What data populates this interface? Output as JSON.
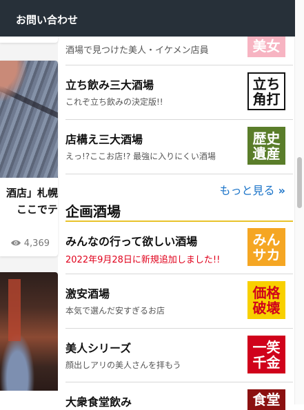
{
  "header": {
    "title": "お問い合わせ"
  },
  "left_cards": {
    "card1": {
      "title_line1": "酒店」札幌",
      "title_line2": "ここでテ",
      "views": "4,369"
    }
  },
  "ranking_items": [
    {
      "desc": "酒場で見つけた美人・イケメン店員",
      "icon_text": "美女",
      "icon_bg": "#f7b4c2",
      "icon_fg": "#ffffff"
    },
    {
      "title": "立ち飲み三大酒場",
      "desc": "これぞ立ち飲みの決定版!!",
      "icon_text": "立ち\n角打",
      "icon_bg": "#ffffff",
      "icon_fg": "#111111"
    },
    {
      "title": "店構え三大酒場",
      "desc": "えっ!?ここお店!? 最強に入りにくい酒場",
      "icon_text": "歴史\n遺産",
      "icon_bg": "#5a7d2a",
      "icon_fg": "#ffffff"
    }
  ],
  "more_link": {
    "label": "もっと見る",
    "icon": "double-chevron-right-icon"
  },
  "section": {
    "heading": "企画酒場",
    "items": [
      {
        "title": "みんなの行って欲しい酒場",
        "desc": "2022年9月28日に新規追加しました!!",
        "icon_text": "みん\nサカ",
        "icon_bg": "#f5a623",
        "icon_fg": "#ffffff"
      },
      {
        "title": "激安酒場",
        "desc": "本気で選んだ安すぎるお店",
        "icon_text": "価格\n破壊",
        "icon_bg": "#f8d000",
        "icon_fg": "#d0021b"
      },
      {
        "title": "美人シリーズ",
        "desc": "顔出しアリの美人さんを拝もう",
        "icon_text": "一笑\n千金",
        "icon_bg": "#d0021b",
        "icon_fg": "#ffffff"
      },
      {
        "title": "大衆食堂飲み",
        "icon_text": "食堂",
        "icon_bg": "#8b1010",
        "icon_fg": "#ffffff"
      }
    ]
  },
  "colors": {
    "header_bg": "#273039",
    "accent_link": "#1a73c8",
    "section_underline": "#e8c22a",
    "new_text": "#e0001b"
  }
}
